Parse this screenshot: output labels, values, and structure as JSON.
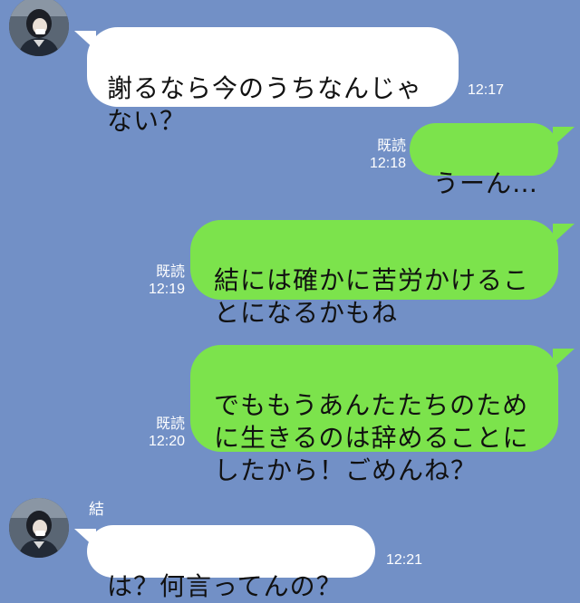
{
  "messages": [
    {
      "direction": "incoming",
      "text": "謝るなら今のうちなんじゃ\nない？",
      "time": "12:17"
    },
    {
      "direction": "outgoing",
      "text": "うーん…",
      "read": "既読",
      "time": "12:18"
    },
    {
      "direction": "outgoing",
      "text": "結には確かに苦労かけるこ\nとになるかもね",
      "read": "既読",
      "time": "12:19"
    },
    {
      "direction": "outgoing",
      "text": "でももうあんたたちのため\nに生きるのは辞めることに\nしたから！ごめんね？",
      "read": "既読",
      "time": "12:20"
    },
    {
      "direction": "incoming",
      "sender": "結",
      "text": "は？何言ってんの？",
      "time": "12:21"
    }
  ],
  "colors": {
    "background": "#7290c6",
    "incoming_bubble": "#ffffff",
    "outgoing_bubble": "#7ce34c",
    "meta_text": "#ffffff"
  }
}
